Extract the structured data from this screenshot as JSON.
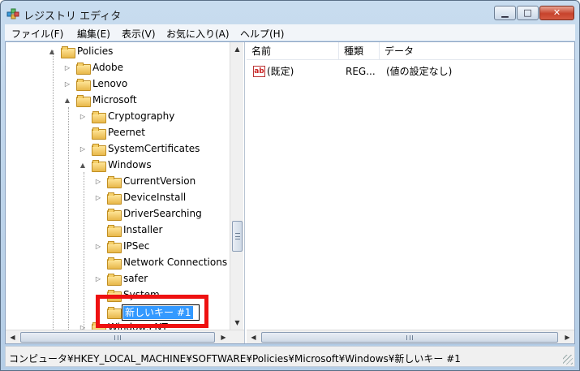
{
  "window": {
    "title": "レジストリ エディタ"
  },
  "menu": [
    "ファイル(F)",
    "編集(E)",
    "表示(V)",
    "お気に入り(A)",
    "ヘルプ(H)"
  ],
  "tree": {
    "items": [
      {
        "label": "Policies",
        "expander": "▲"
      },
      {
        "label": "Adobe",
        "expander": "▷"
      },
      {
        "label": "Lenovo",
        "expander": "▷"
      },
      {
        "label": "Microsoft",
        "expander": "▲"
      },
      {
        "label": "Cryptography",
        "expander": "▷"
      },
      {
        "label": "Peernet",
        "expander": ""
      },
      {
        "label": "SystemCertificates",
        "expander": "▷"
      },
      {
        "label": "Windows",
        "expander": "▲"
      },
      {
        "label": "CurrentVersion",
        "expander": "▷"
      },
      {
        "label": "DeviceInstall",
        "expander": "▷"
      },
      {
        "label": "DriverSearching",
        "expander": ""
      },
      {
        "label": "Installer",
        "expander": ""
      },
      {
        "label": "IPSec",
        "expander": "▷"
      },
      {
        "label": "Network Connections",
        "expander": ""
      },
      {
        "label": "safer",
        "expander": "▷"
      },
      {
        "label": "System",
        "expander": ""
      },
      {
        "label": "",
        "expander": ""
      },
      {
        "label": "Windows NT",
        "expander": "▷"
      }
    ],
    "editing_value": "新しいキー #1"
  },
  "list": {
    "columns": [
      "名前",
      "種類",
      "データ"
    ],
    "rows": [
      {
        "name": "(既定)",
        "type": "REG...",
        "data": "(値の設定なし)",
        "icon": "ab"
      }
    ]
  },
  "scroll": {
    "grip": "III"
  },
  "status": {
    "path": "コンピュータ¥HKEY_LOCAL_MACHINE¥SOFTWARE¥Policies¥Microsoft¥Windows¥新しいキー #1"
  }
}
